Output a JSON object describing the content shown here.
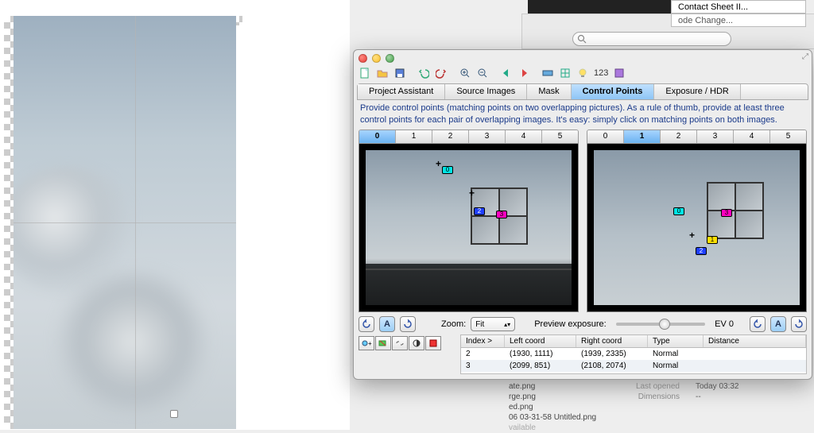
{
  "menus": {
    "contact_sheet": "Contact Sheet II...",
    "mode_change": "ode Change..."
  },
  "toolbar_num": "123",
  "tabs": {
    "project": "Project Assistant",
    "source": "Source Images",
    "mask": "Mask",
    "control": "Control Points",
    "exposure": "Exposure / HDR"
  },
  "instruction": "Provide control points (matching points on two overlapping pictures). As a rule of thumb, provide at least three control points for each pair of overlapping images. It's easy: simply click on matching points on both images.",
  "image_tabs_left": [
    "0",
    "1",
    "2",
    "3",
    "4",
    "5"
  ],
  "image_tabs_right": [
    "0",
    "1",
    "2",
    "3",
    "4",
    "5"
  ],
  "selected_left": "0",
  "selected_right": "1",
  "zoom_label": "Zoom:",
  "zoom_value": "Fit",
  "preview_label": "Preview exposure:",
  "ev_label": "EV 0",
  "table": {
    "headers": {
      "index": "Index >",
      "left": "Left coord",
      "right": "Right coord",
      "type": "Type",
      "dist": "Distance"
    },
    "rows": [
      {
        "index": "2",
        "left": "(1930, 1111)",
        "right": "(1939, 2335)",
        "type": "Normal",
        "dist": ""
      },
      {
        "index": "3",
        "left": "(2099, 851)",
        "right": "(2108, 2074)",
        "type": "Normal",
        "dist": ""
      }
    ]
  },
  "control_points": {
    "left": [
      {
        "id": "0",
        "color": "#00e5e5"
      },
      {
        "id": "2",
        "color": "#2040ff"
      },
      {
        "id": "3",
        "color": "#ff00c0"
      }
    ],
    "right": [
      {
        "id": "0",
        "color": "#00e5e5"
      },
      {
        "id": "1",
        "color": "#ffe000"
      },
      {
        "id": "2",
        "color": "#2040ff"
      },
      {
        "id": "3",
        "color": "#ff00c0"
      }
    ]
  },
  "file_info": {
    "last_opened_label": "Last opened",
    "last_opened_value": "Today 03:32",
    "dimensions_label": "Dimensions",
    "dimensions_value": "--"
  },
  "file_list": [
    "ate.png",
    "rge.png",
    "ed.png",
    "06 03-31-58 Untitled.png",
    "vailable"
  ]
}
